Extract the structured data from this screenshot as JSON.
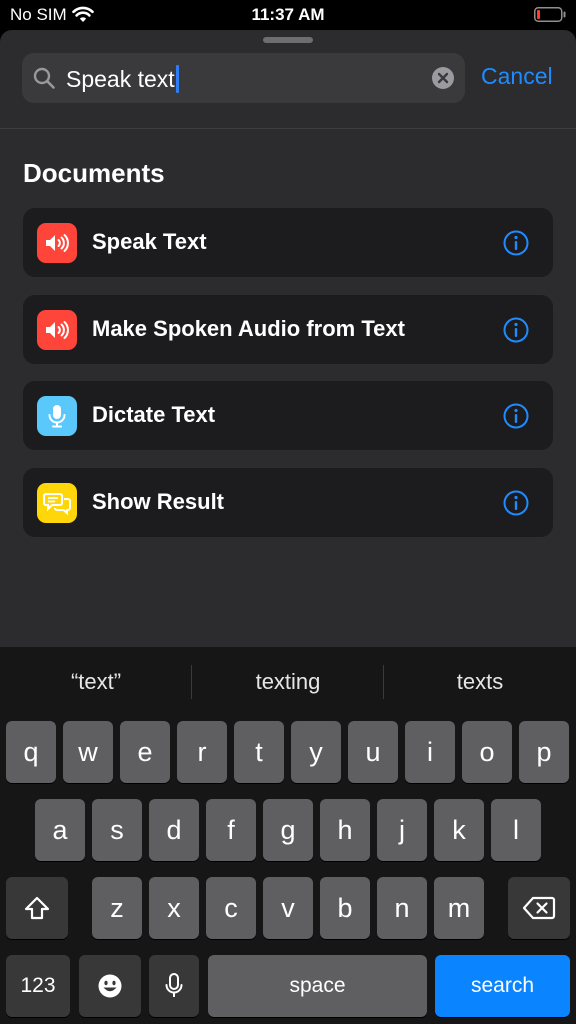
{
  "status_bar": {
    "carrier": "No SIM",
    "time": "11:37 AM"
  },
  "search": {
    "query": "Speak text",
    "cancel_label": "Cancel"
  },
  "section": {
    "title": "Documents"
  },
  "actions": [
    {
      "label": "Speak Text",
      "icon": "speaker-icon",
      "color": "#ff453a"
    },
    {
      "label": "Make Spoken Audio from Text",
      "icon": "speaker-icon",
      "color": "#ff453a"
    },
    {
      "label": "Dictate Text",
      "icon": "microphone-icon",
      "color": "#5ac8fa"
    },
    {
      "label": "Show Result",
      "icon": "speech-bubbles-icon",
      "color": "#ffd60a"
    }
  ],
  "keyboard": {
    "suggestions": [
      "“text”",
      "texting",
      "texts"
    ],
    "row1": [
      "q",
      "w",
      "e",
      "r",
      "t",
      "y",
      "u",
      "i",
      "o",
      "p"
    ],
    "row2": [
      "a",
      "s",
      "d",
      "f",
      "g",
      "h",
      "j",
      "k",
      "l"
    ],
    "row3": [
      "z",
      "x",
      "c",
      "v",
      "b",
      "n",
      "m"
    ],
    "numbers_label": "123",
    "space_label": "space",
    "search_label": "search"
  },
  "colors": {
    "accent": "#1f8bff",
    "sheet_background": "#2c2c2e",
    "row_background": "#1c1c1e"
  }
}
